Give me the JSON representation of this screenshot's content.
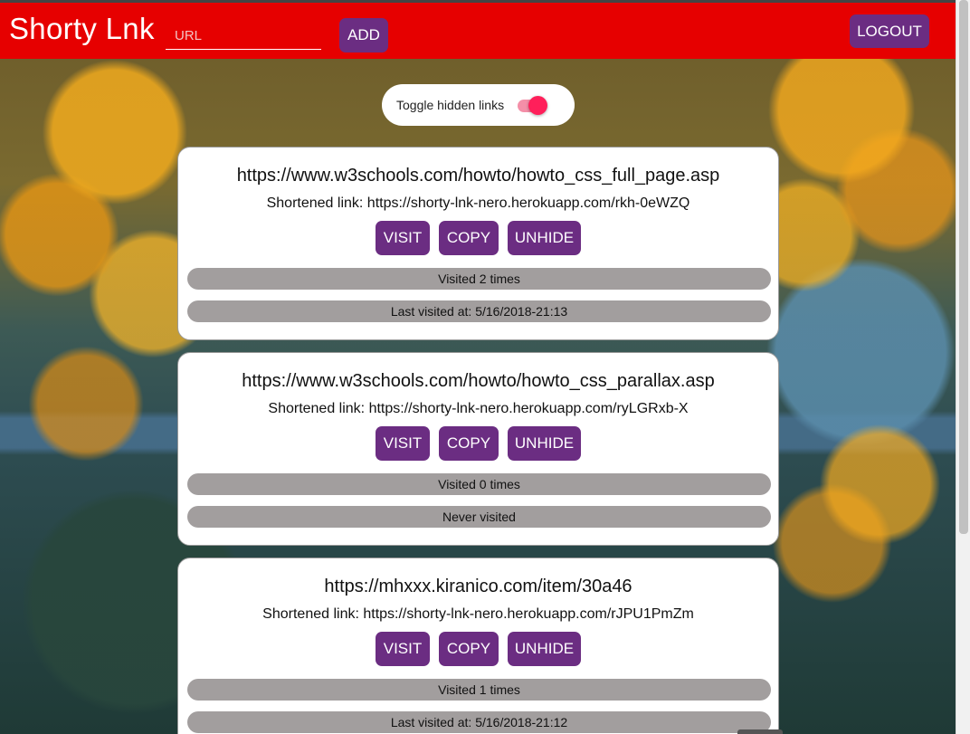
{
  "header": {
    "brand": "Shorty Lnk",
    "url_placeholder": "URL",
    "add_label": "ADD",
    "logout_label": "LOGOUT"
  },
  "toggle": {
    "label": "Toggle hidden links",
    "enabled": true
  },
  "links": [
    {
      "url": "https://www.w3schools.com/howto/howto_css_full_page.asp",
      "short": "Shortened link: https://shorty-lnk-nero.herokuapp.com/rkh-0eWZQ",
      "visit_label": "VISIT",
      "copy_label": "COPY",
      "unhide_label": "UNHIDE",
      "visits": "Visited 2 times",
      "last_visited": "Last visited at: 5/16/2018-21:13"
    },
    {
      "url": "https://www.w3schools.com/howto/howto_css_parallax.asp",
      "short": "Shortened link: https://shorty-lnk-nero.herokuapp.com/ryLGRxb-X",
      "visit_label": "VISIT",
      "copy_label": "COPY",
      "unhide_label": "UNHIDE",
      "visits": "Visited 0 times",
      "last_visited": "Never visited"
    },
    {
      "url": "https://mhxxx.kiranico.com/item/30a46",
      "short": "Shortened link: https://shorty-lnk-nero.herokuapp.com/rJPU1PmZm",
      "visit_label": "VISIT",
      "copy_label": "COPY",
      "unhide_label": "UNHIDE",
      "visits": "Visited 1 times",
      "last_visited": "Last visited at: 5/16/2018-21:12"
    }
  ],
  "colors": {
    "header_bg": "#e60000",
    "button_bg": "#6b2d82",
    "stat_bar_bg": "#a29e9e",
    "toggle_thumb": "#ff1f5a"
  }
}
